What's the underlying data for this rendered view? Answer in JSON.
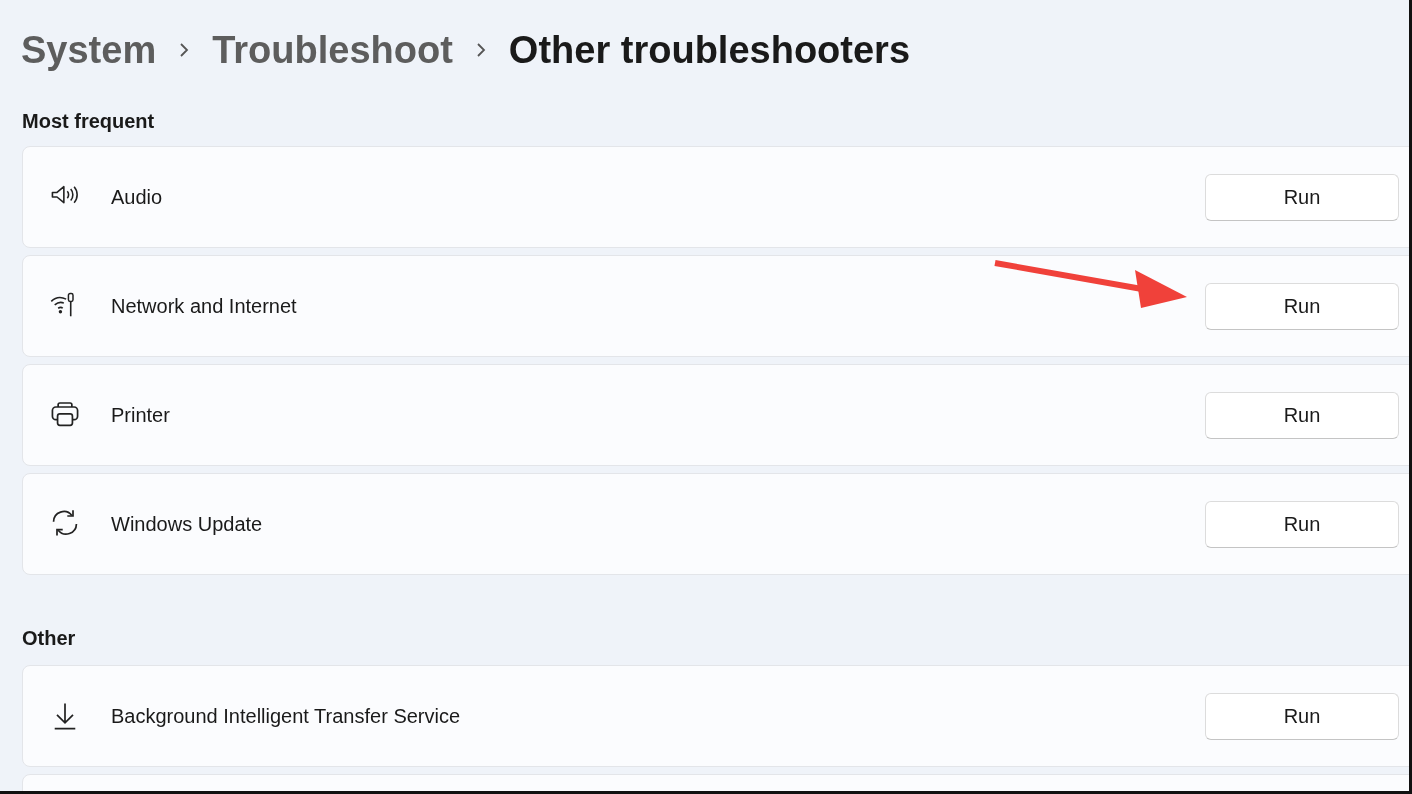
{
  "breadcrumb": [
    {
      "label": "System",
      "current": false
    },
    {
      "label": "Troubleshoot",
      "current": false
    },
    {
      "label": "Other troubleshooters",
      "current": true
    }
  ],
  "sections": [
    {
      "title": "Most frequent",
      "items": [
        {
          "kind": "speaker",
          "label": "Audio",
          "button": "Run"
        },
        {
          "kind": "network",
          "label": "Network and Internet",
          "button": "Run"
        },
        {
          "kind": "printer",
          "label": "Printer",
          "button": "Run"
        },
        {
          "kind": "sync",
          "label": "Windows Update",
          "button": "Run"
        }
      ]
    },
    {
      "title": "Other",
      "items": [
        {
          "kind": "download",
          "label": "Background Intelligent Transfer Service",
          "button": "Run"
        }
      ]
    }
  ]
}
